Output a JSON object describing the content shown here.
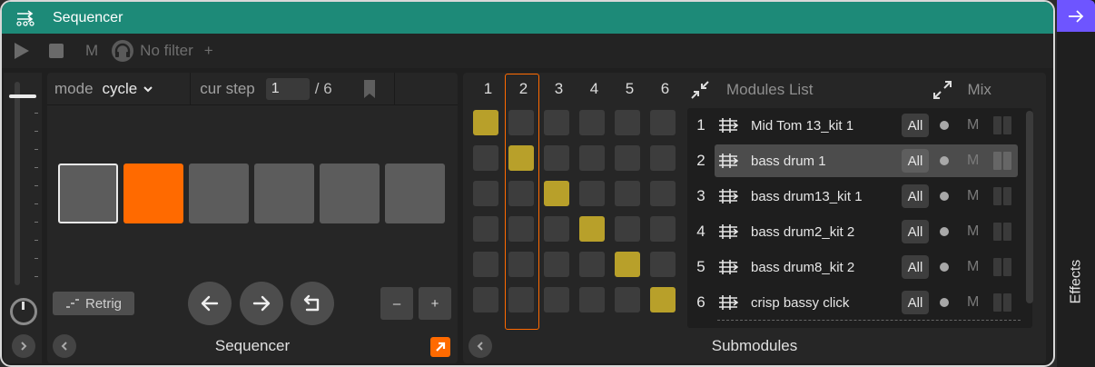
{
  "window": {
    "title": "Sequencer"
  },
  "transport": {
    "mute_label": "M",
    "filter_label": "No filter",
    "add_label": "+"
  },
  "sequencer": {
    "mode_label": "mode",
    "mode_value": "cycle",
    "cur_step_label": "cur step",
    "cur_step_value": "1",
    "total_steps_label": "/ 6",
    "steps": [
      {
        "state": "selected"
      },
      {
        "state": "active"
      },
      {
        "state": "off"
      },
      {
        "state": "off"
      },
      {
        "state": "off"
      },
      {
        "state": "off"
      }
    ],
    "retrig_label": "Retrig",
    "minus_label": "–",
    "plus_label": "+",
    "footer_label": "Sequencer"
  },
  "submodules": {
    "columns": [
      "1",
      "2",
      "3",
      "4",
      "5",
      "6"
    ],
    "selected_column": "2",
    "grid_active": [
      [
        0
      ],
      [
        1
      ],
      [
        2
      ],
      [
        3
      ],
      [
        4
      ],
      [
        5
      ]
    ],
    "list_title": "Modules List",
    "mix_label": "Mix",
    "modules": [
      {
        "num": "1",
        "name": "Mid Tom 13_kit 1",
        "all": "All",
        "m": "M"
      },
      {
        "num": "2",
        "name": "bass drum 1",
        "all": "All",
        "m": "M",
        "selected": true
      },
      {
        "num": "3",
        "name": "bass drum13_kit 1",
        "all": "All",
        "m": "M"
      },
      {
        "num": "4",
        "name": "bass drum2_kit 2",
        "all": "All",
        "m": "M"
      },
      {
        "num": "5",
        "name": "bass drum8_kit 2",
        "all": "All",
        "m": "M"
      },
      {
        "num": "6",
        "name": "crisp bassy click",
        "all": "All",
        "m": "M"
      }
    ],
    "footer_label": "Submodules"
  },
  "effects": {
    "label": "Effects"
  },
  "colors": {
    "title_bar": "#1d8a78",
    "accent_orange": "#ff6a00",
    "active_cell": "#b8a02a",
    "effects_bar": "#6e55ff"
  }
}
